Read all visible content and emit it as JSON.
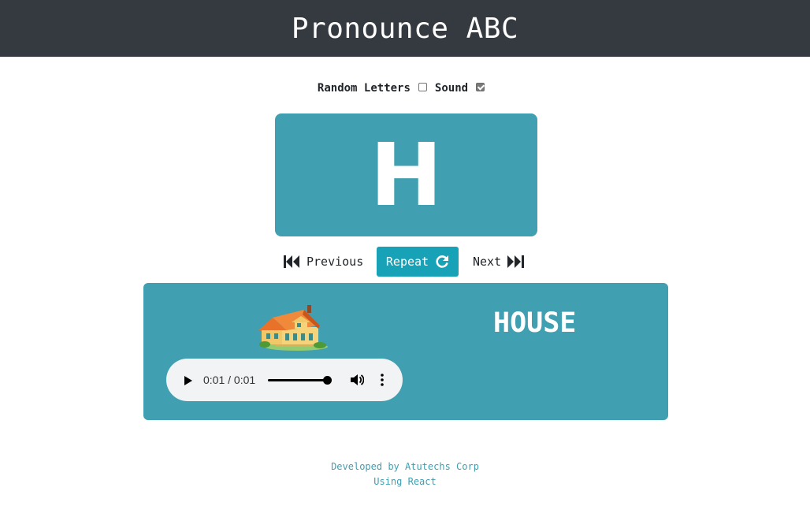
{
  "header": {
    "title": "Pronounce ABC"
  },
  "options": {
    "random_letters_label": "Random Letters",
    "random_letters_checked": false,
    "sound_label": "Sound",
    "sound_checked": true
  },
  "letter_card": {
    "letter": "H"
  },
  "controls": {
    "previous_label": "Previous",
    "repeat_label": "Repeat",
    "next_label": "Next"
  },
  "word_card": {
    "word": "HOUSE",
    "image_icon": "house-icon"
  },
  "audio_player": {
    "time": "0:01 / 0:01",
    "progress": 1.0
  },
  "footer": {
    "line1": "Developed by Atutechs Corp",
    "line2": "Using React"
  },
  "colors": {
    "header_bg": "#343a40",
    "card_bg": "#409fb0",
    "button_bg": "#17a2b8",
    "footer_text": "#409fb0"
  }
}
